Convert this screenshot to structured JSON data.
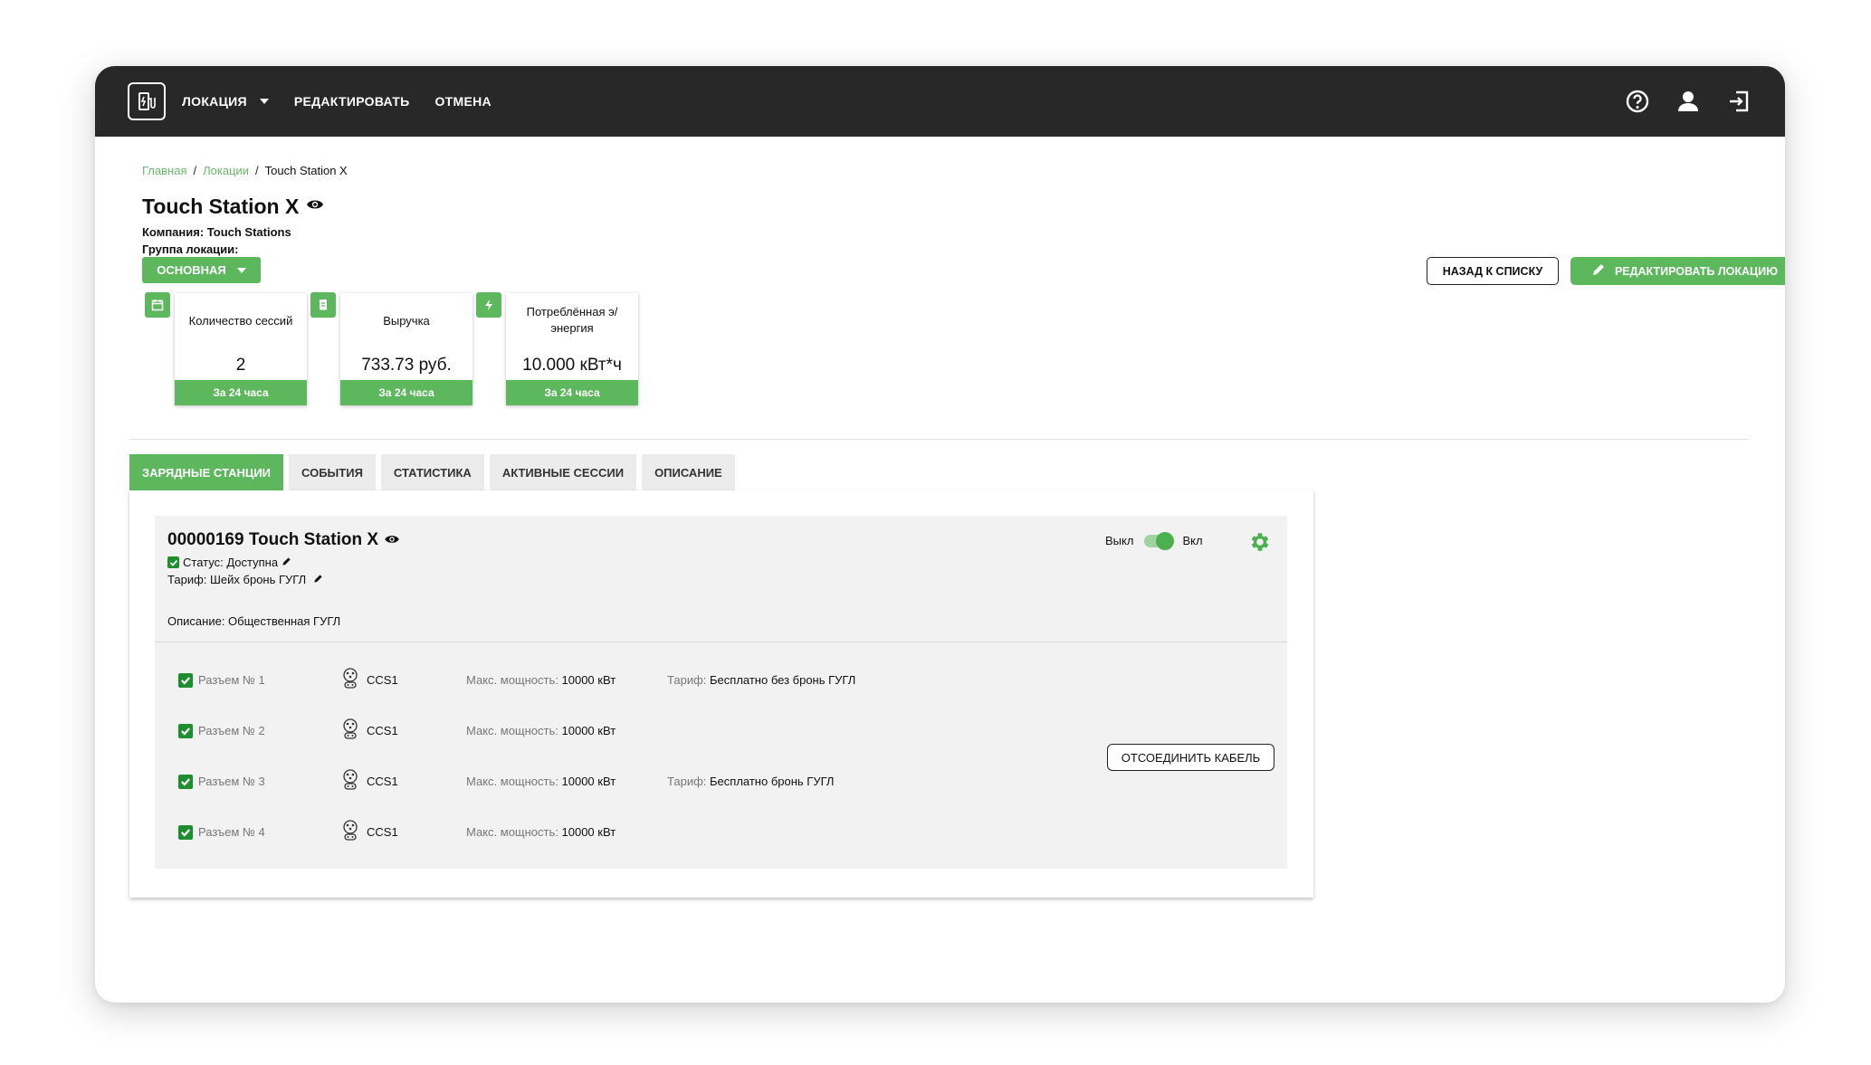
{
  "topbar": {
    "menu": [
      {
        "label": "ЛОКАЦИЯ",
        "has_dropdown": true
      },
      {
        "label": "РЕДАКТИРОВАТЬ"
      },
      {
        "label": "ОТМЕНА"
      }
    ],
    "icons": [
      "help-icon",
      "user-icon",
      "logout-icon"
    ]
  },
  "breadcrumb": {
    "home": "Главная",
    "locations": "Локации",
    "current": "Touch Station X"
  },
  "location": {
    "title": "Touch Station X",
    "company": "Компания: Touch Stations",
    "group_label": "Группа локации:",
    "group_value": "ОСНОВНАЯ"
  },
  "actions": {
    "back": "НАЗАД К СПИСКУ",
    "edit": "РЕДАКТИРОВАТЬ ЛОКАЦИЮ"
  },
  "stats": [
    {
      "label": "Количество сессий",
      "value": "2",
      "period": "За 24 часа",
      "icon": "calendar-icon"
    },
    {
      "label": "Выручка",
      "value": "733.73 руб.",
      "period": "За 24 часа",
      "icon": "receipt-icon"
    },
    {
      "label": "Потреблённая э/энергия",
      "value": "10.000 кВт*ч",
      "period": "За 24 часа",
      "icon": "lightning-icon"
    }
  ],
  "tabs": [
    {
      "label": "ЗАРЯДНЫЕ СТАНЦИИ",
      "active": true
    },
    {
      "label": "СОБЫТИЯ"
    },
    {
      "label": "СТАТИСТИКА"
    },
    {
      "label": "АКТИВНЫЕ СЕССИИ"
    },
    {
      "label": "ОПИСАНИЕ"
    }
  ],
  "station": {
    "title": "00000169 Touch Station X",
    "status": "Статус: Доступна",
    "tariff": "Тариф: Шейх бронь ГУГЛ",
    "description": "Описание: Общественная ГУГЛ",
    "toggle_off": "Выкл",
    "toggle_on": "Вкл",
    "cable_button": "ОТСОЕДИНИТЬ КАБЕЛЬ",
    "connectors": [
      {
        "name": "Разъем № 1",
        "type": "CCS1",
        "power_label": "Макс. мощность:",
        "power": "10000 кВт",
        "tariff_label": "Тариф:",
        "tariff": "Бесплатно без бронь ГУГЛ"
      },
      {
        "name": "Разъем № 2",
        "type": "CCS1",
        "power_label": "Макс. мощность:",
        "power": "10000 кВт",
        "tariff_label": "",
        "tariff": ""
      },
      {
        "name": "Разъем № 3",
        "type": "CCS1",
        "power_label": "Макс. мощность:",
        "power": "10000 кВт",
        "tariff_label": "Тариф:",
        "tariff": "Бесплатно бронь ГУГЛ"
      },
      {
        "name": "Разъем № 4",
        "type": "CCS1",
        "power_label": "Макс. мощность:",
        "power": "10000 кВт",
        "tariff_label": "",
        "tariff": ""
      }
    ]
  },
  "colors": {
    "accent": "#5db85d",
    "topbar": "#282828",
    "check": "#1e8e2e"
  }
}
